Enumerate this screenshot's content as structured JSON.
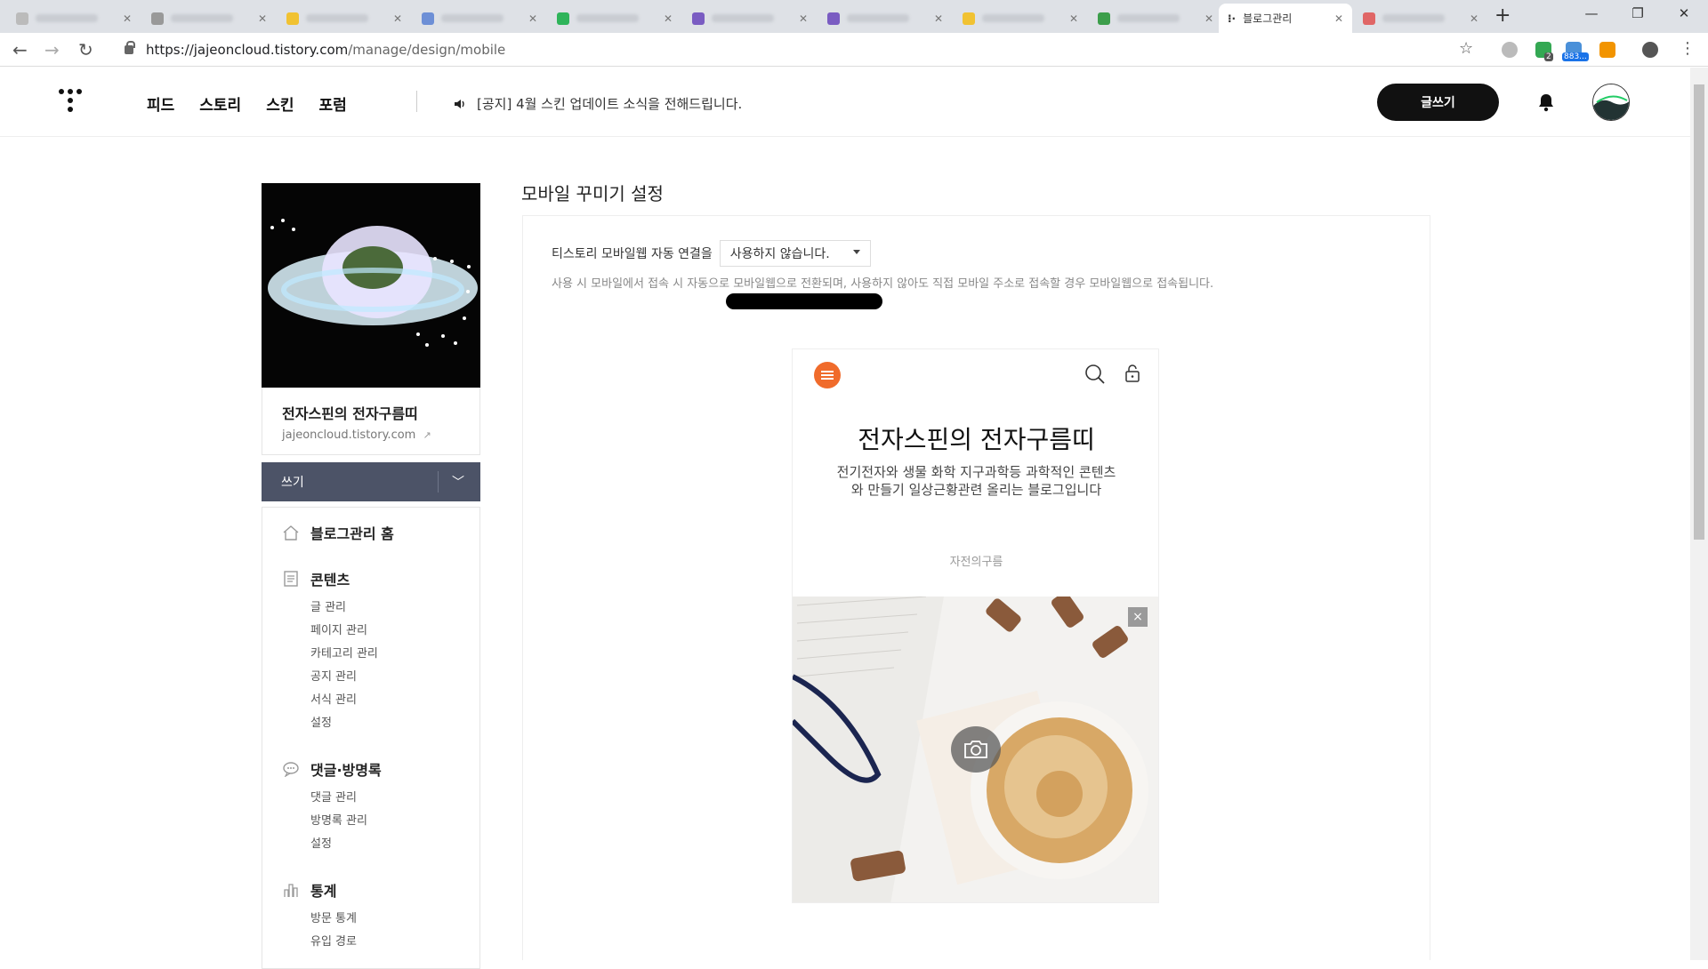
{
  "browser": {
    "active_tab": {
      "title": "블로그관리"
    },
    "url": {
      "host": "https://jajeoncloud.tistory.com",
      "path": "/manage/design/mobile"
    },
    "extension_badges": [
      "2",
      "883..."
    ]
  },
  "header": {
    "nav": [
      "피드",
      "스토리",
      "스킨",
      "포럼"
    ],
    "notice": "[공지] 4월 스킨 업데이트 소식을 전해드립니다.",
    "write_label": "글쓰기"
  },
  "sidebar": {
    "blog_name": "전자스핀의 전자구름띠",
    "blog_url": "jajeoncloud.tistory.com",
    "write_label": "쓰기",
    "home": "블로그관리 홈",
    "groups": [
      {
        "title": "콘텐츠",
        "icon": "document-icon",
        "items": [
          "글 관리",
          "페이지 관리",
          "카테고리 관리",
          "공지 관리",
          "서식 관리",
          "설정"
        ]
      },
      {
        "title": "댓글·방명록",
        "icon": "comment-icon",
        "items": [
          "댓글 관리",
          "방명록 관리",
          "설정"
        ]
      },
      {
        "title": "통계",
        "icon": "bar-chart-icon",
        "items": [
          "방문 통계",
          "유입 경로"
        ]
      }
    ]
  },
  "main": {
    "title": "모바일 꾸미기 설정",
    "setting_label": "티스토리 모바일웹 자동 연결을",
    "setting_value": "사용하지 않습니다.",
    "setting_help": "사용 시 모바일에서 접속 시 자동으로 모바일웹으로 전환되며, 사용하지 않아도 직접 모바일 주소로 접속할 경우 모바일웹으로 접속됩니다."
  },
  "preview": {
    "title": "전자스핀의 전자구름띠",
    "description": "전기전자와 생물 화학 지구과학등 과학적인 콘텐츠와 만들기 일상근황관련 올리는 블로그입니다",
    "author": "자전의구름",
    "close_label": "×"
  },
  "colors": {
    "accent": "#f06b2b",
    "sidebar_button": "#4c5367"
  }
}
